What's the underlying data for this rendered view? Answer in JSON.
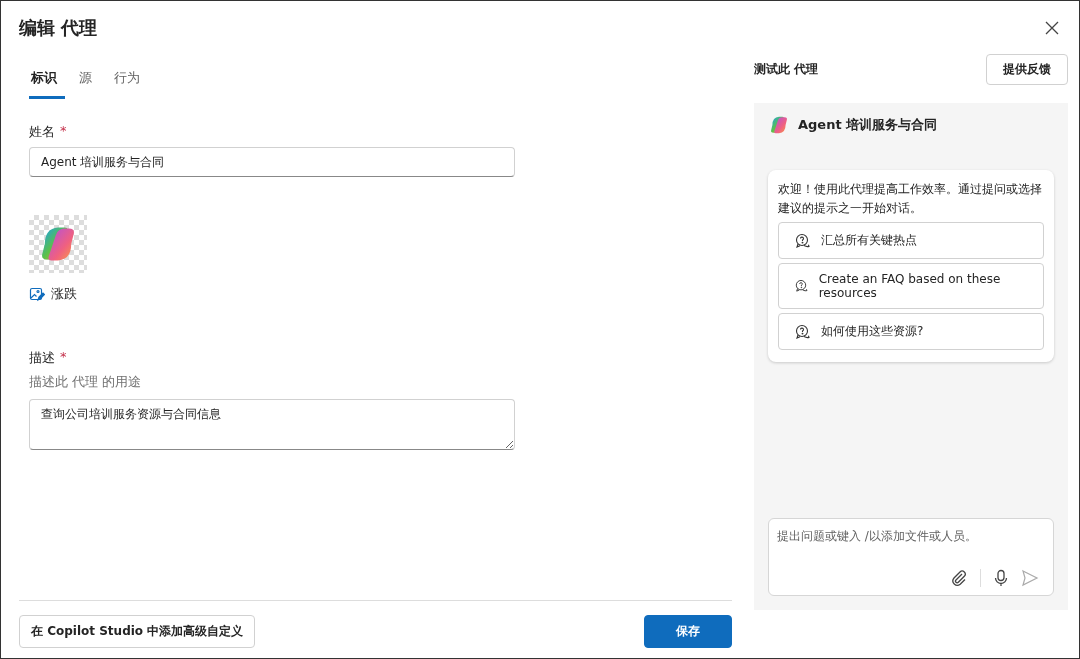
{
  "window": {
    "title": "编辑 代理"
  },
  "tabs": [
    {
      "label": "标识",
      "selected": true
    },
    {
      "label": "源",
      "selected": false
    },
    {
      "label": "行为",
      "selected": false
    }
  ],
  "name_field": {
    "label": "姓名",
    "required_mark": "*",
    "value": "Agent 培训服务与合同"
  },
  "icon_section": {
    "change_label": "涨跌"
  },
  "description_field": {
    "label": "描述",
    "required_mark": "*",
    "hint": "描述此 代理 的用途",
    "value": "查询公司培训服务资源与合同信息"
  },
  "footer": {
    "customize_button": "在 Copilot Studio 中添加高级自定义",
    "save_button": "保存"
  },
  "test_panel": {
    "title": "测试此 代理",
    "feedback_button": "提供反馈",
    "agent_name": "Agent 培训服务与合同",
    "welcome": "欢迎！使用此代理提高工作效率。通过提问或选择建议的提示之一开始对话。",
    "suggestions": [
      "汇总所有关键热点",
      "Create an FAQ based on these resources",
      "如何使用这些资源?"
    ],
    "composer": {
      "placeholder": "提出问题或键入 /以添加文件或人员。"
    }
  }
}
